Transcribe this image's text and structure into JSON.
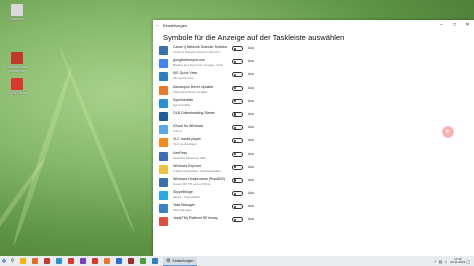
{
  "desktop": {
    "icons": [
      {
        "label": "Papierkorb",
        "color": "#d9d9d9"
      },
      {
        "label": "Bildsitzungs Bausteine",
        "color": "#c0392b"
      },
      {
        "label": "WMW Benzs",
        "color": "#d63a2f"
      }
    ]
  },
  "window": {
    "app_title": "Einstellungen",
    "heading": "Symbole für die Anzeige auf der Taskleiste auswählen",
    "toggle_label": "Aus",
    "rows": [
      {
        "name": "Canon ij Network Scanner Selector",
        "sub": "Canon ij Network Scanner Selector",
        "icon_color": "#3a6fb0"
      },
      {
        "name": "googledrivesync.exe",
        "sub": "Backup and Sync from Google - Verb",
        "icon_color": "#4285f4"
      },
      {
        "name": "MG Quick View",
        "sub": "MG Quick View",
        "icon_color": "#2d7fc1"
      },
      {
        "name": "Ashampoo Driver Updater",
        "sub": "Ashampoo Driver Updater",
        "icon_color": "#e8792b"
      },
      {
        "name": "Synchredible",
        "sub": "Synchredible",
        "icon_color": "#2a8fd6"
      },
      {
        "name": "OLB Onlinebanking Starter",
        "sub": "",
        "icon_color": "#1f5c99"
      },
      {
        "name": "iCloud für Windows",
        "sub": "iCloud",
        "icon_color": "#5aa7e6"
      },
      {
        "name": "VLC media player",
        "sub": "VLC media player",
        "icon_color": "#f28c1b"
      },
      {
        "name": "KeePass",
        "sub": "KeePass Password Safe",
        "icon_color": "#3d6db5"
      },
      {
        "name": "Windows Explorer",
        "sub": "3 Sicherheitsrisiken Schwachstellen",
        "icon_color": "#f0c040"
      },
      {
        "name": "Windows-Hostprozess (Rundll32)",
        "sub": "Canon MX770 series Printer",
        "icon_color": "#3a6fb0"
      },
      {
        "name": "SkypeBridge",
        "sub": "Skype - Angemeldet",
        "icon_color": "#2aa7e6"
      },
      {
        "name": "Task Manager",
        "sub": "Task Manager",
        "icon_color": "#3a7fc1"
      },
      {
        "name": "Java(TM) Platform SE binary",
        "sub": "",
        "icon_color": "#e04f3a"
      }
    ]
  },
  "taskbar": {
    "settings_label": "Einstellungen",
    "time": "17:30",
    "date": "03.11.2019",
    "apps": [
      "#f5b400",
      "#e66a1f",
      "#c33b2e",
      "#2a8fd6",
      "#d63a2f",
      "#7a3fc1",
      "#d8392b",
      "#e8792b",
      "#2b6fd6",
      "#9e2b2b",
      "#4a9d3a",
      "#2d7fc1"
    ]
  }
}
